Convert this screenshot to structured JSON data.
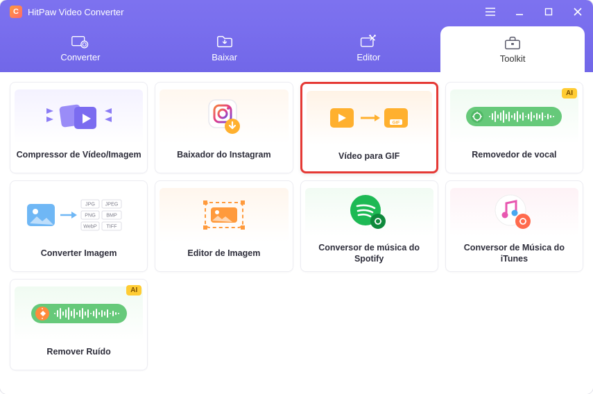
{
  "app": {
    "title": "HitPaw Video Converter",
    "logo_letter": "C"
  },
  "tabs": {
    "converter": "Converter",
    "baixar": "Baixar",
    "editor": "Editor",
    "toolkit": "Toolkit"
  },
  "tools": {
    "compressor": {
      "label": "Compressor de Vídeo/Imagem"
    },
    "instagram": {
      "label": "Baixador do Instagram"
    },
    "video_gif": {
      "label": "Vídeo para GIF"
    },
    "vocal_remover": {
      "label": "Removedor de vocal",
      "badge": "AI"
    },
    "image_converter": {
      "label": "Converter Imagem",
      "formats": [
        "JPG",
        "JPEG",
        "PNG",
        "BMP",
        "WebP",
        "TIFF"
      ]
    },
    "image_editor": {
      "label": "Editor de Imagem"
    },
    "spotify": {
      "label": "Conversor de música do Spotify"
    },
    "itunes": {
      "label": "Conversor de Música do iTunes"
    },
    "noise": {
      "label": "Remover Ruído",
      "badge": "AI"
    }
  },
  "gif_label": "GIF"
}
